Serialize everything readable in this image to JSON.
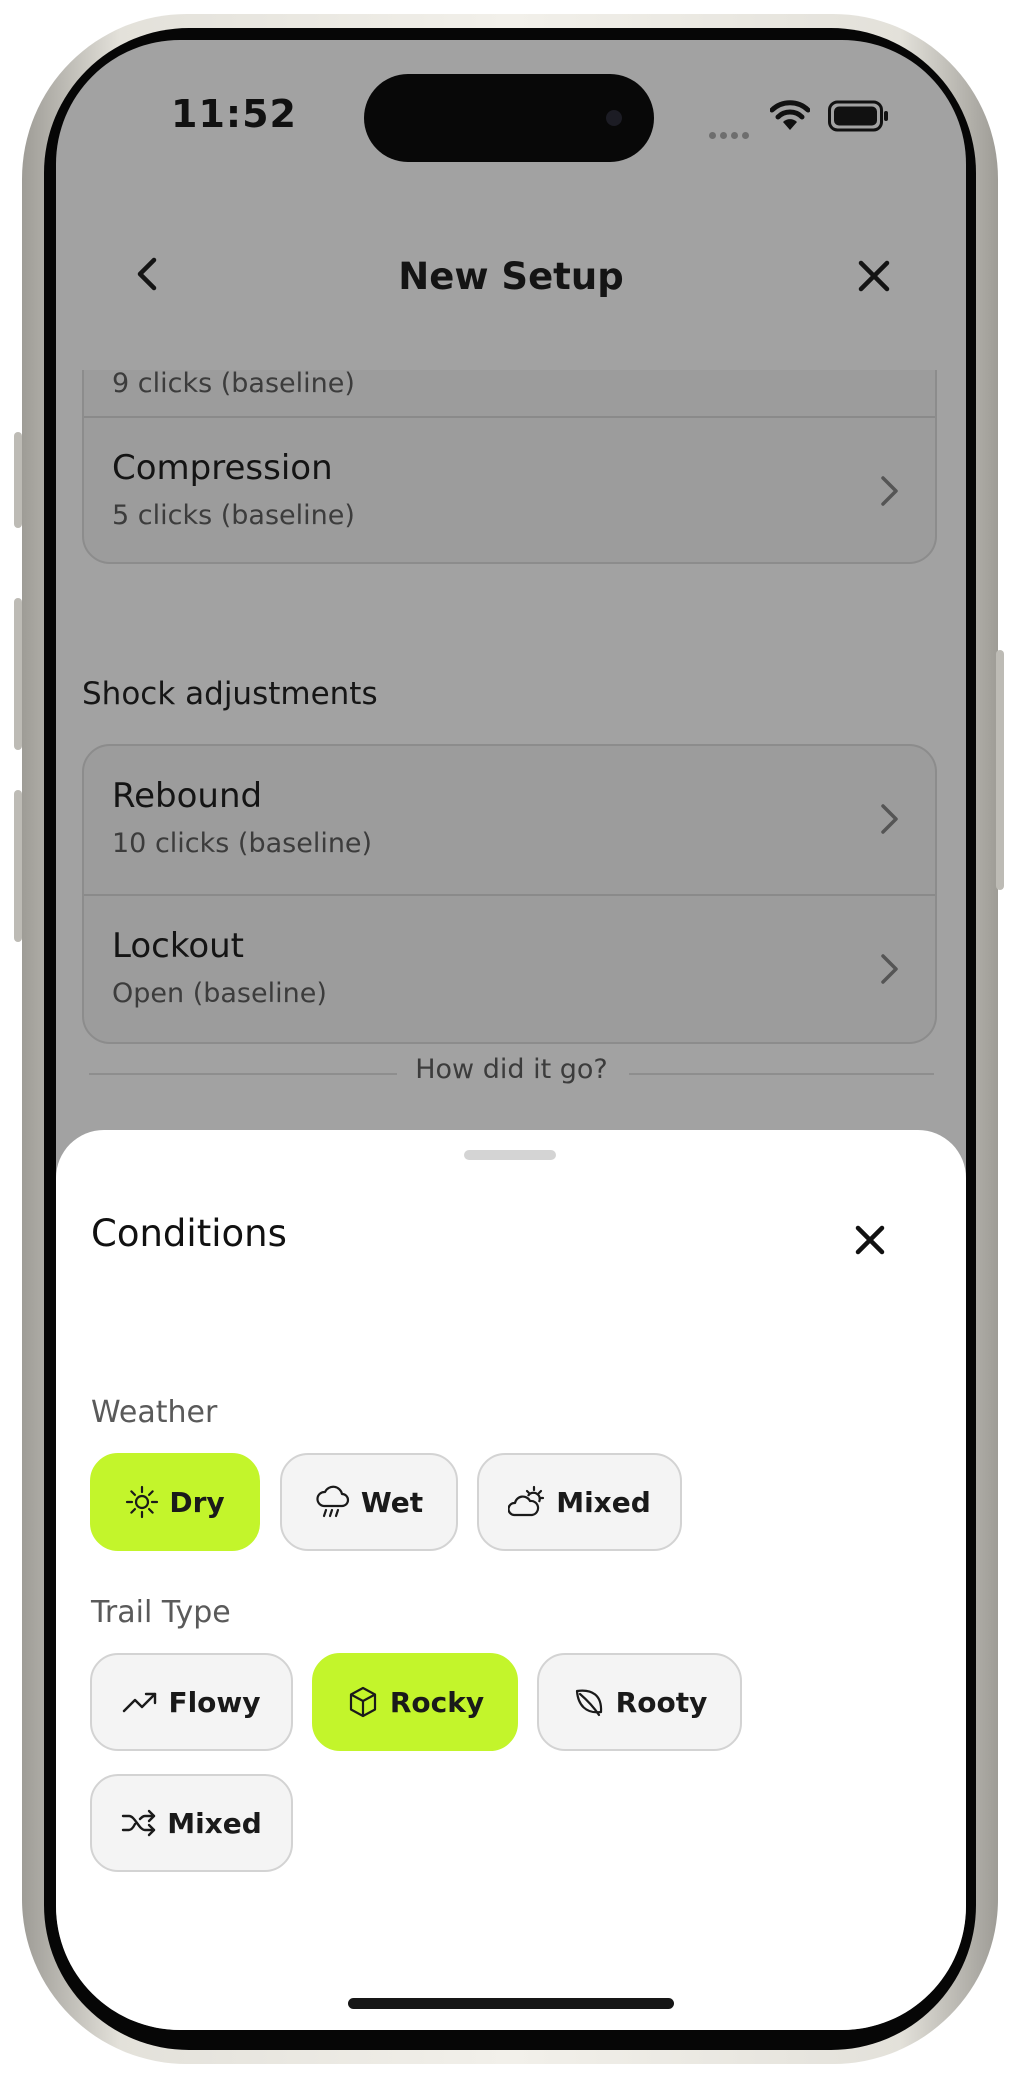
{
  "status_bar": {
    "time": "11:52"
  },
  "nav": {
    "title": "New Setup",
    "back_icon": "chevron-left-icon",
    "close_icon": "close-icon"
  },
  "fork_adjustments": {
    "items": [
      {
        "label": "",
        "value": "9 clicks (baseline)"
      },
      {
        "label": "Compression",
        "value": "5 clicks (baseline)"
      }
    ]
  },
  "shock_adjustments": {
    "label": "Shock adjustments",
    "items": [
      {
        "label": "Rebound",
        "value": "10 clicks (baseline)"
      },
      {
        "label": "Lockout",
        "value": "Open (baseline)"
      }
    ]
  },
  "feedback": {
    "label": "How did it go?"
  },
  "sheet": {
    "title": "Conditions",
    "weather": {
      "label": "Weather",
      "options": [
        {
          "label": "Dry",
          "icon": "sun-icon",
          "selected": true
        },
        {
          "label": "Wet",
          "icon": "rain-cloud-icon",
          "selected": false
        },
        {
          "label": "Mixed",
          "icon": "cloud-sun-icon",
          "selected": false
        }
      ]
    },
    "trail_type": {
      "label": "Trail Type",
      "options": [
        {
          "label": "Flowy",
          "icon": "trending-up-icon",
          "selected": false
        },
        {
          "label": "Rocky",
          "icon": "box-icon",
          "selected": true
        },
        {
          "label": "Rooty",
          "icon": "leaf-icon",
          "selected": false
        },
        {
          "label": "Mixed",
          "icon": "shuffle-icon",
          "selected": false
        }
      ]
    }
  },
  "colors": {
    "accent": "#C3F52B",
    "chip_bg": "#F4F4F4",
    "scrim": "#A2A2A2"
  }
}
